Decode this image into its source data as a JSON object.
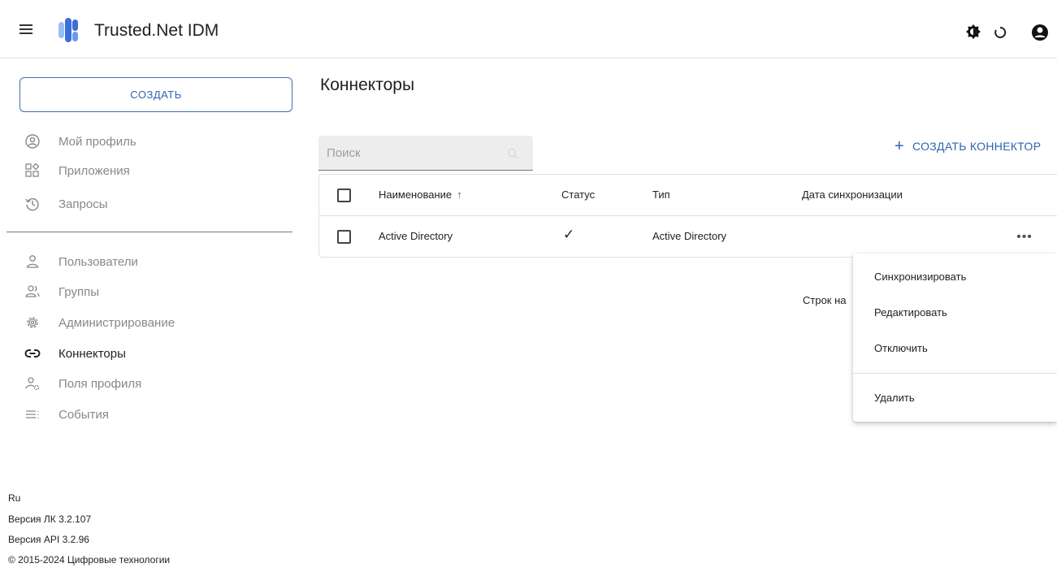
{
  "header": {
    "app_title": "Trusted.Net IDM",
    "icons": [
      "menu-icon",
      "theme-icon",
      "refresh-icon",
      "account-icon"
    ]
  },
  "sidebar": {
    "create_label": "СОЗДАТЬ",
    "items_top": [
      {
        "label": "Мой профиль",
        "icon": "profile-icon"
      },
      {
        "label": "Приложения",
        "icon": "apps-icon"
      },
      {
        "label": "Запросы",
        "icon": "history-icon"
      }
    ],
    "items_admin": [
      {
        "label": "Пользователи",
        "icon": "user-icon"
      },
      {
        "label": "Группы",
        "icon": "group-icon"
      },
      {
        "label": "Администрирование",
        "icon": "settings-icon"
      },
      {
        "label": "Коннекторы",
        "icon": "link-icon",
        "active": true
      },
      {
        "label": "Поля профиля",
        "icon": "user-settings-icon"
      },
      {
        "label": "События",
        "icon": "events-icon"
      }
    ],
    "footer": {
      "lang": "Ru",
      "version_lk": "Версия ЛК 3.2.107",
      "version_api": "Версия API 3.2.96",
      "copyright": "© 2015-2024 Цифровые технологии"
    }
  },
  "main": {
    "title": "Коннекторы",
    "search": {
      "placeholder": "Поиск",
      "value": ""
    },
    "add_connector_label": "СОЗДАТЬ КОННЕКТОР",
    "table": {
      "columns": [
        "Наименование",
        "Статус",
        "Тип",
        "Дата синхронизации"
      ],
      "sort_indicator": "↑",
      "rows": [
        {
          "name": "Active Directory",
          "status": "✓",
          "type": "Active Directory",
          "sync_date": ""
        }
      ]
    },
    "rows_per_page_label": "Строк на"
  },
  "context_menu": {
    "items": [
      "Синхронизировать",
      "Редактировать",
      "Отключить",
      "Удалить"
    ]
  },
  "colors": {
    "accent": "#2f64b0",
    "logo_blue": "#3b6fd8",
    "logo_light": "#9bbdf2"
  }
}
